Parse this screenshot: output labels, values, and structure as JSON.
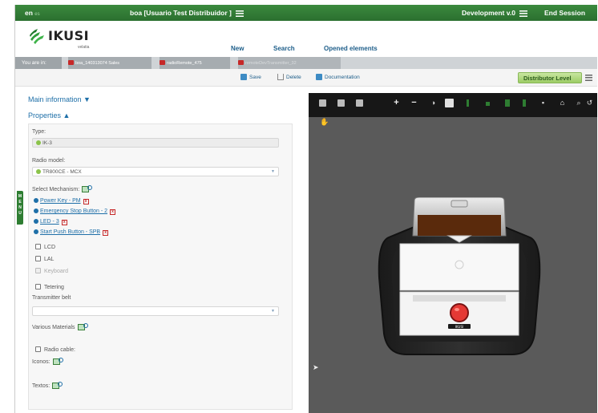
{
  "topbar": {
    "lang": "en",
    "lang_extra": "es",
    "user": "boa [Usuario Test Distribuidor ]",
    "environment": "Development v.0",
    "end_session": "End Session"
  },
  "header": {
    "logo_text": "IKUSI",
    "logo_sub": "velatia",
    "nav": [
      "New",
      "Search",
      "Opened elements"
    ]
  },
  "breadcrumb": {
    "label": "You are in:",
    "items": [
      "boa_140313074 Sales",
      "radioRemote_475",
      "remoteDevTransmitter_32"
    ]
  },
  "toolbar": {
    "save": "Save",
    "delete": "Delete",
    "documentation": "Documentation",
    "level": "Distributor Level"
  },
  "sidetab": "MENU",
  "sections": {
    "main_information": "Main information ▼",
    "properties": "Properties ▲"
  },
  "form": {
    "type_label": "Type:",
    "type_value": "IK-3",
    "radio_model_label": "Radio model:",
    "radio_model_value": "TR800CE - MCX",
    "mechanism_label": "Select Mechanism:",
    "mechanisms": [
      "Power Key - PM",
      "Emergency Stop Button - 2",
      "LED - 3",
      "Start Push Button - SPB"
    ],
    "checkbox_lcd": "LCD",
    "checkbox_lal": "LAL",
    "checkbox_keyboard": "Keyboard",
    "checkbox_tetering": "Tetering",
    "transmitter_belt_label": "Transmitter belt",
    "transmitter_belt_value": "",
    "various_materials_label": "Various Materials",
    "radio_cable_label": "Radio cable:",
    "iconos_label": "Iconos:",
    "textos_label": "Textos:"
  },
  "colors": {
    "topbar": "#2b6f2f",
    "accent": "#1e6fa8",
    "level_badge": "#9ccc65",
    "viewer_bg": "#5a5a5a",
    "device_display": "#5a2a0c",
    "emergency_button": "#e53935"
  }
}
